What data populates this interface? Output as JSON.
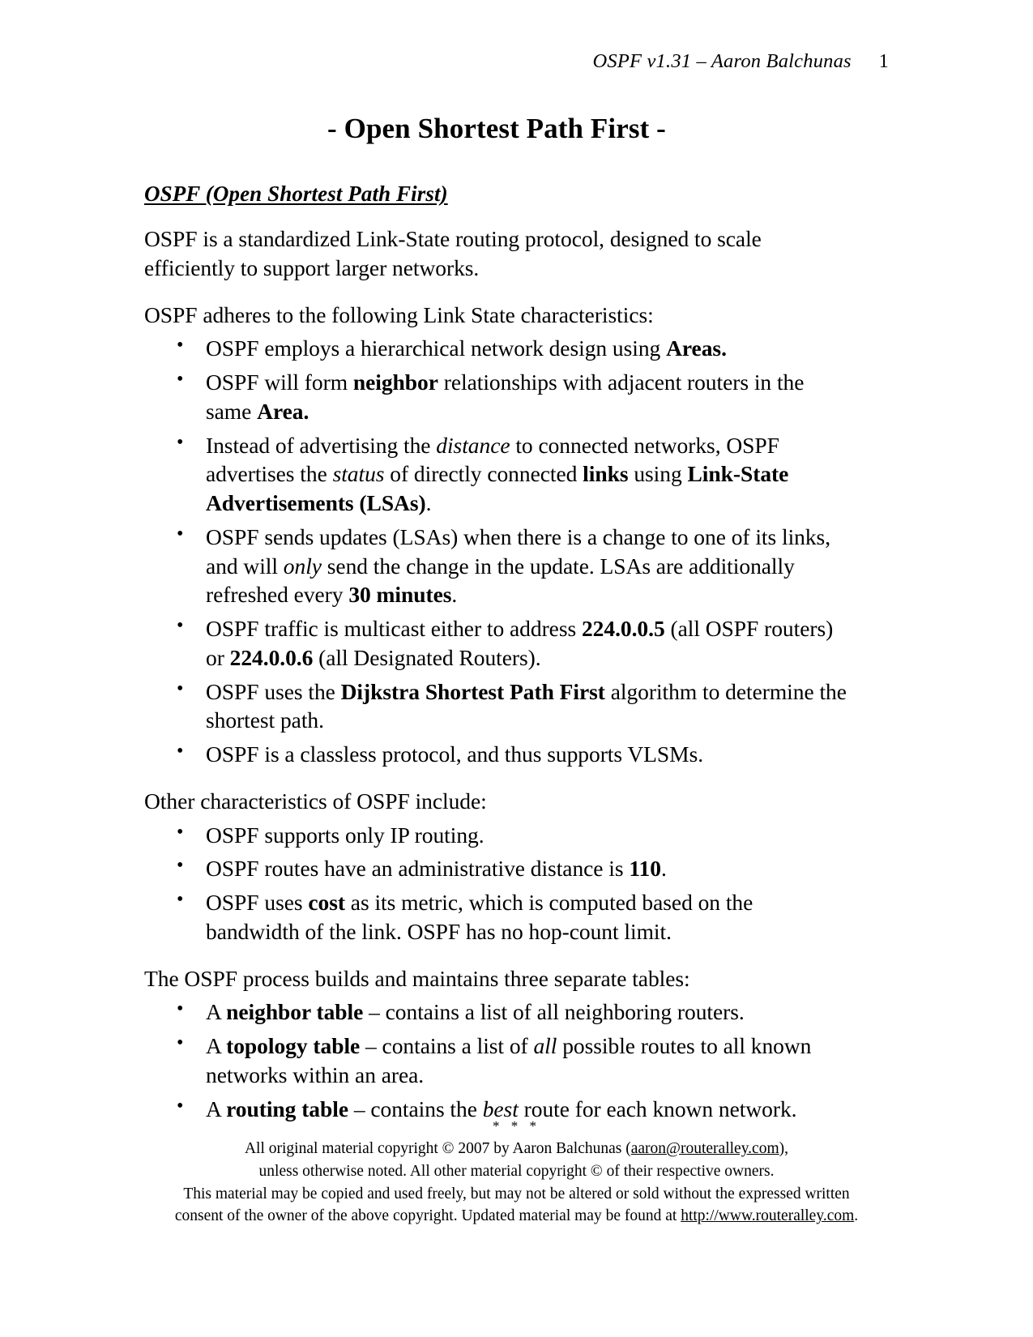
{
  "header": {
    "running_head": "OSPF v1.31 – Aaron Balchunas",
    "page_number": "1"
  },
  "title": "- Open Shortest Path First -",
  "section": {
    "heading": "OSPF (Open Shortest Path First)",
    "intro": "OSPF is a standardized Link-State routing protocol, designed to scale efficiently to support larger networks."
  },
  "link_state": {
    "lead": "OSPF adheres to the following Link State characteristics:",
    "items": [
      {
        "parts": [
          {
            "text": "OSPF employs a hierarchical network design using ",
            "style": "normal"
          },
          {
            "text": "Areas.",
            "style": "bold"
          }
        ]
      },
      {
        "parts": [
          {
            "text": "OSPF will form ",
            "style": "normal"
          },
          {
            "text": "neighbor",
            "style": "bold"
          },
          {
            "text": " relationships with adjacent routers in the same ",
            "style": "normal"
          },
          {
            "text": "Area.",
            "style": "bold"
          }
        ]
      },
      {
        "parts": [
          {
            "text": "Instead of advertising the ",
            "style": "normal"
          },
          {
            "text": "distance",
            "style": "italic"
          },
          {
            "text": " to connected networks, OSPF advertises the ",
            "style": "normal"
          },
          {
            "text": "status",
            "style": "italic"
          },
          {
            "text": " of directly connected ",
            "style": "normal"
          },
          {
            "text": "links",
            "style": "bold"
          },
          {
            "text": " using ",
            "style": "normal"
          },
          {
            "text": "Link-State Advertisements (LSAs)",
            "style": "bold"
          },
          {
            "text": ".",
            "style": "normal"
          }
        ]
      },
      {
        "parts": [
          {
            "text": "OSPF sends updates (LSAs) when there is a change to one of its links, and will ",
            "style": "normal"
          },
          {
            "text": "only",
            "style": "italic"
          },
          {
            "text": " send the change in the update. LSAs are additionally refreshed every ",
            "style": "normal"
          },
          {
            "text": "30 minutes",
            "style": "bold"
          },
          {
            "text": ".",
            "style": "normal"
          }
        ]
      },
      {
        "parts": [
          {
            "text": "OSPF traffic is multicast either to address ",
            "style": "normal"
          },
          {
            "text": "224.0.0.5",
            "style": "bold"
          },
          {
            "text": " (all OSPF routers) or ",
            "style": "normal"
          },
          {
            "text": "224.0.0.6",
            "style": "bold"
          },
          {
            "text": " (all Designated Routers).",
            "style": "normal"
          }
        ]
      },
      {
        "parts": [
          {
            "text": "OSPF uses the ",
            "style": "normal"
          },
          {
            "text": "Dijkstra Shortest Path First",
            "style": "bold"
          },
          {
            "text": " algorithm to determine the shortest path.",
            "style": "normal"
          }
        ]
      },
      {
        "parts": [
          {
            "text": "OSPF is a classless protocol, and thus supports VLSMs.",
            "style": "normal"
          }
        ]
      }
    ]
  },
  "other_characteristics": {
    "lead": "Other characteristics of OSPF include:",
    "items": [
      {
        "parts": [
          {
            "text": "OSPF supports only IP routing.",
            "style": "normal"
          }
        ]
      },
      {
        "parts": [
          {
            "text": "OSPF routes have an administrative distance is ",
            "style": "normal"
          },
          {
            "text": "110",
            "style": "bold"
          },
          {
            "text": ".",
            "style": "normal"
          }
        ]
      },
      {
        "parts": [
          {
            "text": "OSPF uses ",
            "style": "normal"
          },
          {
            "text": "cost",
            "style": "bold"
          },
          {
            "text": " as its metric, which is computed based on the bandwidth of the link. OSPF has no hop-count limit.",
            "style": "normal"
          }
        ]
      }
    ]
  },
  "tables_section": {
    "lead": "The OSPF process builds and maintains three separate tables:",
    "items": [
      {
        "parts": [
          {
            "text": "A ",
            "style": "normal"
          },
          {
            "text": "neighbor table",
            "style": "bold"
          },
          {
            "text": " – contains a list of all neighboring routers.",
            "style": "normal"
          }
        ]
      },
      {
        "parts": [
          {
            "text": "A ",
            "style": "normal"
          },
          {
            "text": "topology table",
            "style": "bold"
          },
          {
            "text": " – contains a list of ",
            "style": "normal"
          },
          {
            "text": "all",
            "style": "italic"
          },
          {
            "text": " possible routes to all known networks within an area.",
            "style": "normal"
          }
        ]
      },
      {
        "parts": [
          {
            "text": "A ",
            "style": "normal"
          },
          {
            "text": "routing table",
            "style": "bold"
          },
          {
            "text": " – contains the ",
            "style": "normal"
          },
          {
            "text": "best",
            "style": "italic"
          },
          {
            "text": " route for each known network.",
            "style": "normal"
          }
        ]
      }
    ]
  },
  "footer": {
    "separator": "* * *",
    "line1_before": "All original material copyright © 2007 by Aaron Balchunas (",
    "line1_link": "aaron@routeralley.com",
    "line1_after": "),",
    "line2": "unless otherwise noted.  All other material copyright © of their respective owners.",
    "line3": "This material may be copied and used freely, but may not be altered or sold without the expressed written",
    "line4_before": "consent of the owner of the above copyright. Updated material may be found at ",
    "line4_link": "http://www.routeralley.com",
    "line4_after": "."
  }
}
